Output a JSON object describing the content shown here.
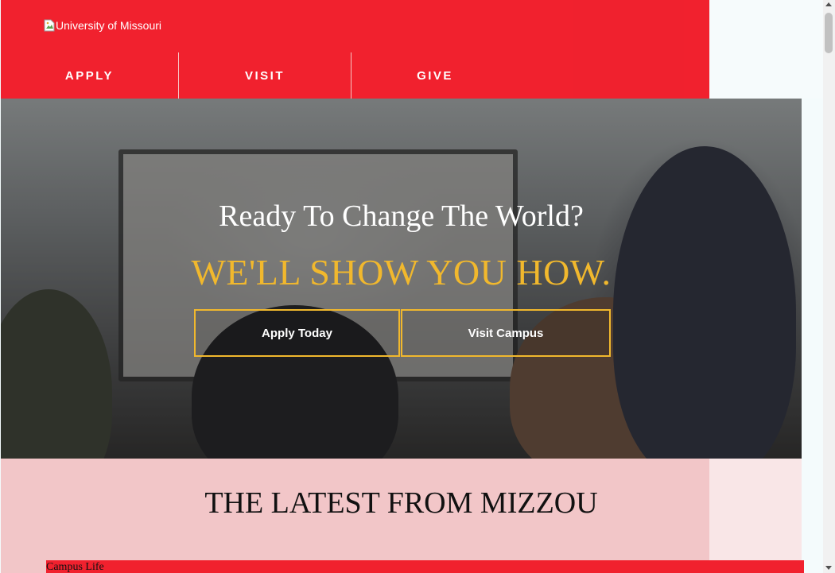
{
  "header": {
    "logo_alt": "University of Missouri",
    "nav": [
      {
        "label": "APPLY"
      },
      {
        "label": "VISIT"
      },
      {
        "label": "GIVE"
      }
    ]
  },
  "hero": {
    "heading": "Ready To Change The World?",
    "tagline": "WE'LL SHOW YOU HOW.",
    "cta_apply": "Apply Today",
    "cta_visit": "Visit Campus"
  },
  "latest": {
    "title": "THE LATEST FROM MIZZOU",
    "category": "Campus Life"
  },
  "colors": {
    "brand_red": "#f1212e",
    "accent_gold": "#f1b82d"
  },
  "icons": {
    "logo": "broken-image-icon"
  }
}
